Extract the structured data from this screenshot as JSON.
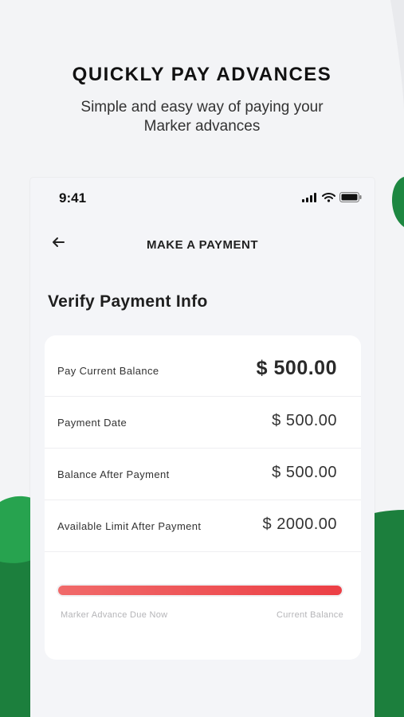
{
  "promo": {
    "headline": "QUICKLY PAY ADVANCES",
    "subline": "Simple and easy way of paying your Marker advances"
  },
  "status_bar": {
    "time": "9:41",
    "icons": [
      "signal-icon",
      "wifi-icon",
      "battery-icon"
    ]
  },
  "header": {
    "back_icon": "back-arrow-icon",
    "title": "MAKE A PAYMENT"
  },
  "section_title": "Verify Payment Info",
  "payment_rows": [
    {
      "label": "Pay Current Balance",
      "value": "$ 500.00"
    },
    {
      "label": "Payment Date",
      "value": "$ 500.00"
    },
    {
      "label": "Balance After Payment",
      "value": "$ 500.00"
    },
    {
      "label": "Available Limit After Payment",
      "value": "$ 2000.00"
    }
  ],
  "progress": {
    "fraction": 1.0,
    "left_caption": "Marker Advance Due Now",
    "right_caption": "Current Balance"
  },
  "colors": {
    "accent_green": "#1d8741",
    "bar_red": "#ec3f45",
    "background": "#f3f4f6"
  }
}
